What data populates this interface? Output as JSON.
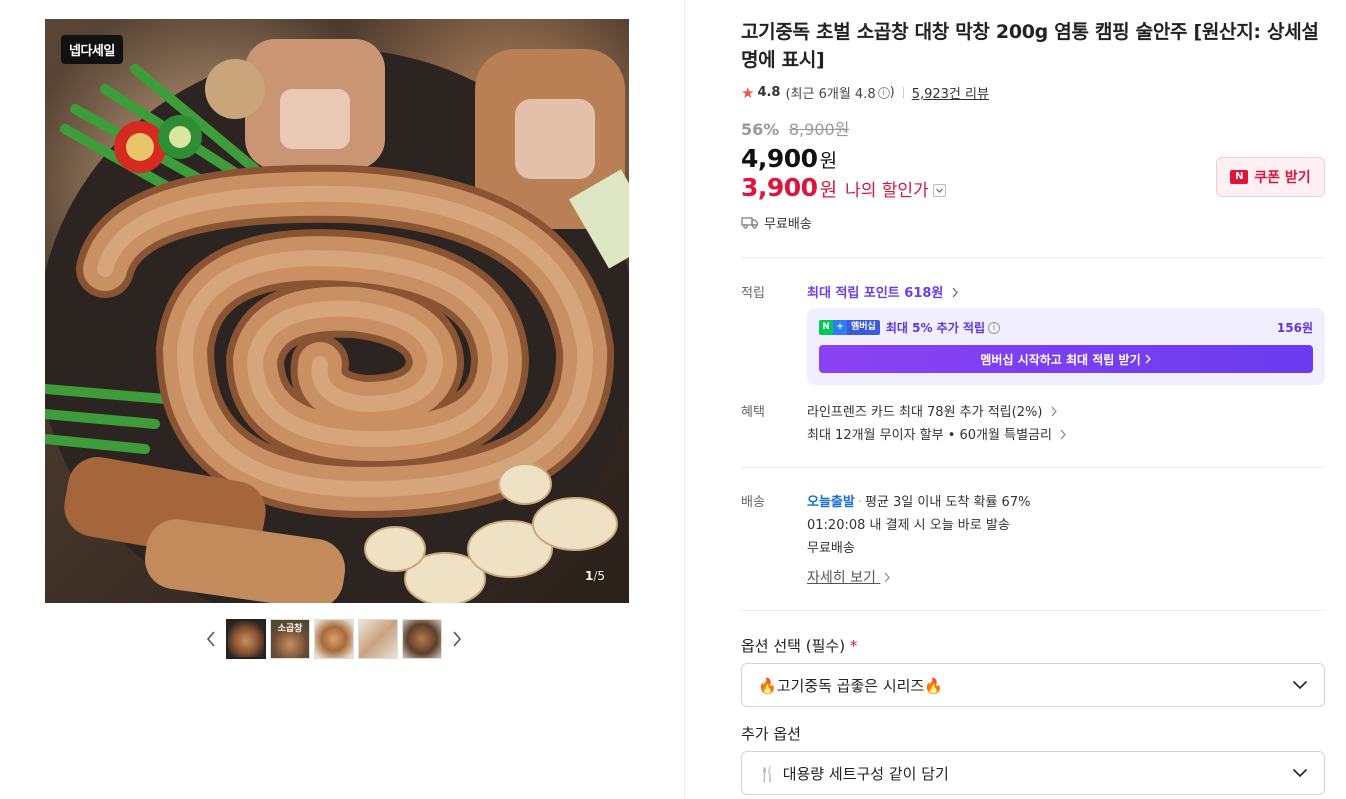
{
  "gallery": {
    "badge": "넵다세일",
    "page_current": "1",
    "page_sep": "/",
    "page_total": "5",
    "thumb_label_2": "소곱창"
  },
  "product": {
    "title": "고기중독 초벌 소곱창 대창 막창 200g 염통 캠핑 술안주 [원산지: 상세설명에 표시]",
    "rating": "4.8",
    "rating_recent": "(최근 6개월 4.8",
    "rating_recent_close": ")",
    "reviews": "5,923건 리뷰",
    "discount": "56%",
    "original_price": "8,900원",
    "price": "4,900",
    "price_unit": "원",
    "my_price": "3,900",
    "my_price_unit": "원",
    "my_price_label": "나의 할인가",
    "coupon": "쿠폰 받기",
    "free_shipping": "무료배송"
  },
  "points": {
    "label": "적립",
    "max_points": "최대 적립 포인트 618원",
    "membership_badge": "멤버십",
    "membership_text": "최대 5% 추가 적립",
    "membership_amount": "156원",
    "membership_button": "멤버십 시작하고 최대 적립 받기"
  },
  "benefits": {
    "label": "혜택",
    "line1": "라인프렌즈 카드 최대 78원 추가 적립(2%)",
    "line2": "최대 12개월 무이자 할부 • 60개월 특별금리"
  },
  "delivery": {
    "label": "배송",
    "today": "오늘출발",
    "probability": "평균 3일 이내 도착 확률 67%",
    "cutoff": "01:20:08  내 결제 시 오늘 바로 발송",
    "free": "무료배송",
    "more": "자세히 보기"
  },
  "options": {
    "required_label": "옵션 선택 (필수)",
    "required_mark": "*",
    "required_value": "고기중독 곱좋은 시리즈",
    "extra_label": "추가 옵션",
    "extra_value": "대용량 세트구성 같이 담기"
  },
  "colors": {
    "accent_red": "#e0133c",
    "accent_purple": "#6a3cf0",
    "today_blue": "#1a6fd4",
    "star": "#f15746"
  }
}
